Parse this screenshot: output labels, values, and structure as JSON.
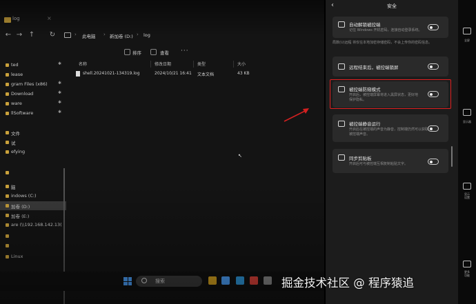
{
  "explorer": {
    "tab_title": "log",
    "tab_close": "×",
    "nav": {
      "back": "←",
      "forward": "→",
      "up": "↑",
      "refresh": "↻"
    },
    "breadcrumb": [
      "此电脑",
      "新加卷 (D:)",
      "log"
    ],
    "breadcrumb_sep": "›",
    "toolbar": {
      "sort_label": "排序",
      "view_label": "查看",
      "more": "···"
    },
    "sidebar": {
      "items": [
        {
          "label": "ted",
          "pinned": true
        },
        {
          "label": "lease",
          "pinned": false
        },
        {
          "label": "gram Files (x86)",
          "pinned": true
        },
        {
          "label": "Download",
          "pinned": true
        },
        {
          "label": "ware",
          "pinned": true
        },
        {
          "label": "llSoftware",
          "pinned": true
        },
        {
          "label": "文件",
          "pinned": false
        },
        {
          "label": "试",
          "pinned": false
        },
        {
          "label": "efying",
          "pinned": false
        },
        {
          "label": "",
          "pinned": false
        },
        {
          "label": "脑",
          "pinned": false
        },
        {
          "label": "indows (C:)",
          "pinned": false
        },
        {
          "label": "加卷 (D:)",
          "pinned": false,
          "selected": true
        },
        {
          "label": "加卷 (E:)",
          "pinned": false
        },
        {
          "label": "are (\\\\192.168.142.13(",
          "pinned": false
        },
        {
          "label": "",
          "pinned": false
        },
        {
          "label": "",
          "pinned": false
        },
        {
          "label": "Linux",
          "pinned": false
        }
      ],
      "pin_glyph": "✱"
    },
    "columns": {
      "name": "名称",
      "modified": "修改日期",
      "type": "类型",
      "size": "大小"
    },
    "files": [
      {
        "name": "shell.20241021-134319.log",
        "modified": "2024/10/21 16:41",
        "type": "文本文档",
        "size": "43 KB"
      }
    ],
    "cursor_glyph": "↖"
  },
  "taskbar": {
    "search_label": "搜索",
    "apps": [
      {
        "name": "file-explorer",
        "color": "#d9a520"
      },
      {
        "name": "app-store",
        "color": "#4da3ff"
      },
      {
        "name": "edge",
        "color": "#2f9be0"
      },
      {
        "name": "chrome",
        "color": "#e0433a"
      },
      {
        "name": "app-generic",
        "color": "#8a8a8a"
      }
    ]
  },
  "panel": {
    "back": "‹",
    "title": "安全",
    "note": "局数(U)远程 将仅在本地加密存储密码，不会上传你的密码信息。",
    "cards": [
      {
        "icon": "lock-icon",
        "title": "自动解锁被控端",
        "desc": [
          "记住 Windows 开机密码，连接自动登录系统。"
        ]
      },
      {
        "icon": "lock-icon",
        "title": "远程结束后，被控端锁屏",
        "desc": []
      },
      {
        "icon": "shield-screen-icon",
        "title": "被控端防窥模式",
        "desc": [
          "开启后，被控端屏幕将进入黑屏状态，更好地",
          "保护隐私。"
        ]
      },
      {
        "icon": "mute-icon",
        "title": "被控端静音运行",
        "desc": [
          "开启后在被控端的声音为静音，控制端仍然可以获取",
          "被控端声音。"
        ]
      },
      {
        "icon": "clipboard-icon",
        "title": "同步剪贴板",
        "desc": [
          "开启后可与被控端互相复制粘贴文字。"
        ]
      }
    ]
  },
  "right_toolbar": {
    "items": [
      {
        "name": "fullscreen",
        "label": "全屏"
      },
      {
        "name": "monitor",
        "label": "显示器"
      },
      {
        "name": "display-settings",
        "label": "显示\n设置"
      },
      {
        "name": "more-functions",
        "label": "更多\n功能"
      }
    ]
  },
  "watermark": "掘金技术社区 @ 程序猿追",
  "colors": {
    "highlight": "#e02020",
    "folder": "#c9a13b",
    "accent": "#4da3ff",
    "arrow": "#d42020"
  }
}
